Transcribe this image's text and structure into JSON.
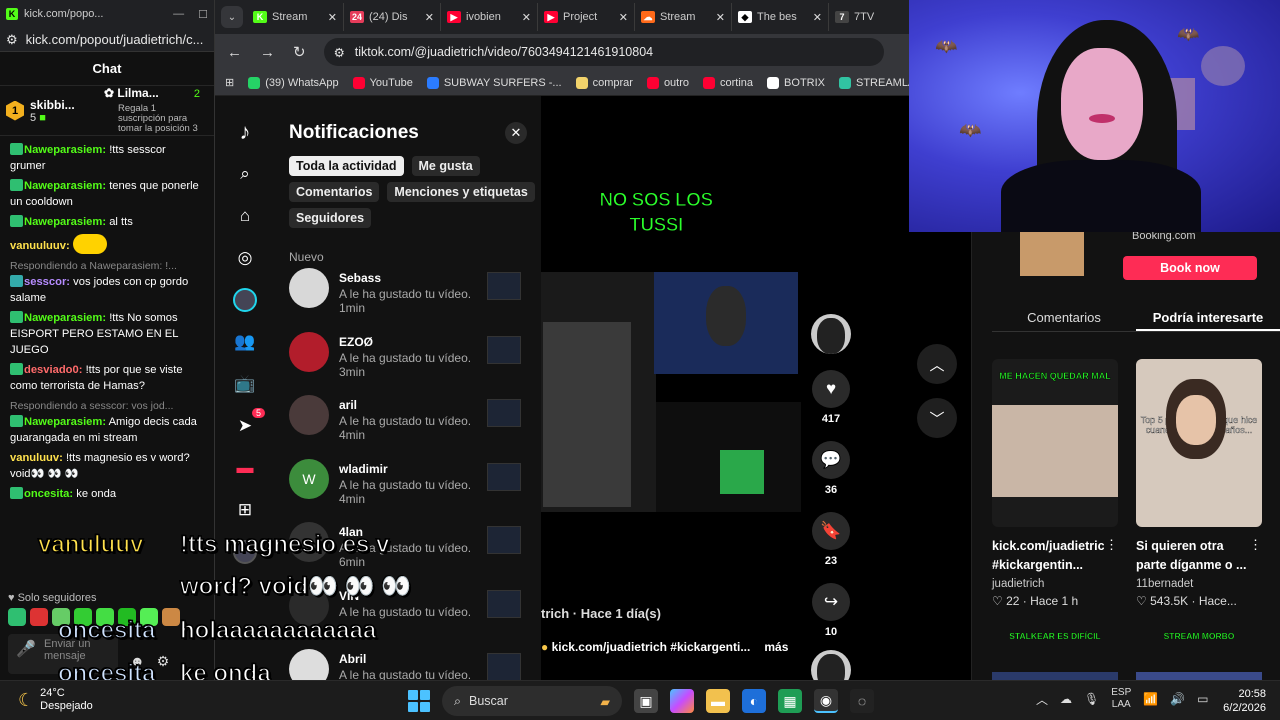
{
  "chat_window": {
    "title": "kick.com/popo...",
    "url": "kick.com/popout/juadietrich/c...",
    "header": "Chat",
    "pinned": {
      "gifter_name": "skibbi...",
      "gifter_count": "5",
      "leader_name": "Lilma...",
      "leader_count": "2",
      "leader_text": "Regala 1 suscripción para tomar la posición 3"
    },
    "messages": [
      {
        "user": "Naweparasiem:",
        "text": "!tts sesscor grumer",
        "color": "green",
        "badge": "g"
      },
      {
        "user": "Naweparasiem:",
        "text": "tenes que ponerle un cooldown",
        "color": "green",
        "badge": "g"
      },
      {
        "user": "Naweparasiem:",
        "text": "al tts",
        "color": "green",
        "badge": "g"
      },
      {
        "user": "vanuuluuv:",
        "text": "",
        "color": "yellow",
        "badge": ""
      },
      {
        "reply": "Respondiendo a Naweparasiem: !...",
        "user": "sesscor:",
        "text": "vos jodes con cp gordo salame",
        "color": "purple",
        "badge": "b"
      },
      {
        "user": "Naweparasiem:",
        "text": "!tts No somos EISPORT PERO ESTAMO EN EL JUEGO",
        "color": "green",
        "badge": "g"
      },
      {
        "user": "desviado0:",
        "text": "!tts por que se viste como terrorista de Hamas?",
        "color": "red",
        "badge": "g"
      },
      {
        "reply": "Respondiendo a sesscor: vos jod...",
        "user": "Naweparasiem:",
        "text": "Amigo decis cada guarangada en mi stream",
        "color": "green",
        "badge": "g"
      },
      {
        "user": "vanuluuv:",
        "text": "!tts magnesio es v word? void👀 👀 👀",
        "color": "yellow",
        "badge": ""
      },
      {
        "user": "oncesita:",
        "text": "ke onda",
        "color": "green",
        "badge": "g"
      }
    ],
    "solo_seguidores": "Solo seguidores",
    "input_placeholder": "Enviar un mensaje"
  },
  "browser": {
    "tabs": [
      {
        "label": "Stream",
        "fav_color": "#53fc18",
        "fav_text": "K"
      },
      {
        "label": "(24) Dis",
        "fav_color": "#e63c5a",
        "fav_text": "24"
      },
      {
        "label": "ivobien",
        "fav_color": "#ff0033",
        "fav_text": "▶"
      },
      {
        "label": "Project",
        "fav_color": "#ff0033",
        "fav_text": "▶"
      },
      {
        "label": "Stream",
        "fav_color": "#ff6a1a",
        "fav_text": "☁"
      },
      {
        "label": "The bes",
        "fav_color": "#ffffff",
        "fav_text": "◆"
      },
      {
        "label": "7TV",
        "fav_color": "#444444",
        "fav_text": "7"
      },
      {
        "label": "",
        "fav_color": "#ffffff",
        "fav_text": "♪"
      }
    ],
    "url": "tiktok.com/@juadietrich/video/7603494121461910804",
    "bookmarks": [
      {
        "label": "(39) WhatsApp",
        "color": "#25d366"
      },
      {
        "label": "YouTube",
        "color": "#ff0033"
      },
      {
        "label": "SUBWAY SURFERS -...",
        "color": "#2b7cff"
      },
      {
        "label": "comprar",
        "color": "#f2d36b"
      },
      {
        "label": "outro",
        "color": "#ff0033"
      },
      {
        "label": "cortina",
        "color": "#ff0033"
      },
      {
        "label": "BOTRIX",
        "color": "#ffffff"
      },
      {
        "label": "STREAMLABS",
        "color": "#31c3a2"
      }
    ]
  },
  "tiktok": {
    "rail_badge": "5",
    "notifications": {
      "title": "Notificaciones",
      "chips": [
        {
          "label": "Toda la actividad",
          "selected": true
        },
        {
          "label": "Me gusta",
          "selected": false
        },
        {
          "label": "Comentarios",
          "selected": false
        },
        {
          "label": "Menciones y etiquetas",
          "selected": false
        },
        {
          "label": "Seguidores",
          "selected": false
        }
      ],
      "section": "Nuevo",
      "items": [
        {
          "name": "Sebass",
          "action": "A le ha gustado tu vídeo.",
          "time": "1min",
          "avatar_color": "#d8d8d8",
          "initial": ""
        },
        {
          "name": "EZOØ",
          "action": "A le ha gustado tu vídeo.",
          "time": "3min",
          "avatar_color": "#b21d2b",
          "initial": ""
        },
        {
          "name": "aril",
          "action": "A le ha gustado tu vídeo.",
          "time": "4min",
          "avatar_color": "#4a3a3a",
          "initial": ""
        },
        {
          "name": "wladimir",
          "action": "A le ha gustado tu vídeo.",
          "time": "4min",
          "avatar_color": "#3c8c3c",
          "initial": "W"
        },
        {
          "name": "4lan",
          "action": "A le ha gustado tu vídeo.",
          "time": "6min",
          "avatar_color": "#333333",
          "initial": ""
        },
        {
          "name": "VIN",
          "action": "A le ha gustado tu vídeo.",
          "time": "",
          "avatar_color": "#2a2a2a",
          "initial": ""
        },
        {
          "name": "Abril",
          "action": "A le ha gustado tu vídeo.",
          "time": "",
          "avatar_color": "#dddddd",
          "initial": ""
        }
      ]
    },
    "video": {
      "overlay_text": "NO SOS LOS TUSSI",
      "author_time": "trich · Hace 1 día(s)",
      "description": "kick.com/juadietrich #kickargenti...",
      "more": "más"
    },
    "actions": {
      "likes": "417",
      "comments": "36",
      "saves": "23",
      "shares": "10"
    },
    "ad": {
      "label": "Booking.com",
      "button": "Book now"
    },
    "right_tabs": [
      {
        "label": "Comentarios",
        "selected": false
      },
      {
        "label": "Podría interesarte",
        "selected": true
      }
    ],
    "recommended": [
      {
        "caption": "ME HACEN QUEDAR MAL",
        "desc": "kick.com/juadietrich #kickargentin...",
        "author": "juadietrich",
        "likes": "22",
        "time": "Hace 1 h"
      },
      {
        "caption": "Top 5 peores Cosas que hice cuando tenía 14/15 años...",
        "desc": "Si quieren otra parte díganme o ...",
        "author": "11bernadet",
        "likes": "543.5K",
        "time": "Hace..."
      }
    ],
    "more_captions": [
      "STALKEAR ES DIFÍCIL",
      "STREAM MORBO"
    ]
  },
  "stream_overlay": [
    {
      "user": "vanuluuv",
      "text": "!tts magnesio es v"
    },
    {
      "user": "",
      "text": "word? void👀 👀 👀"
    },
    {
      "user": "oncesita",
      "text": "holaaaaaaaaaaaa"
    },
    {
      "user": "oncesita",
      "text": "ke onda"
    }
  ],
  "taskbar": {
    "temp": "24°C",
    "weather": "Despejado",
    "search": "Buscar",
    "lang_top": "ESP",
    "lang_bottom": "LAA",
    "time": "20:58",
    "date": "6/2/2026"
  },
  "colors": {
    "kick_green": "#53fc18",
    "tiktok_red": "#fe2c55",
    "overlay_green": "#2bff2b"
  }
}
